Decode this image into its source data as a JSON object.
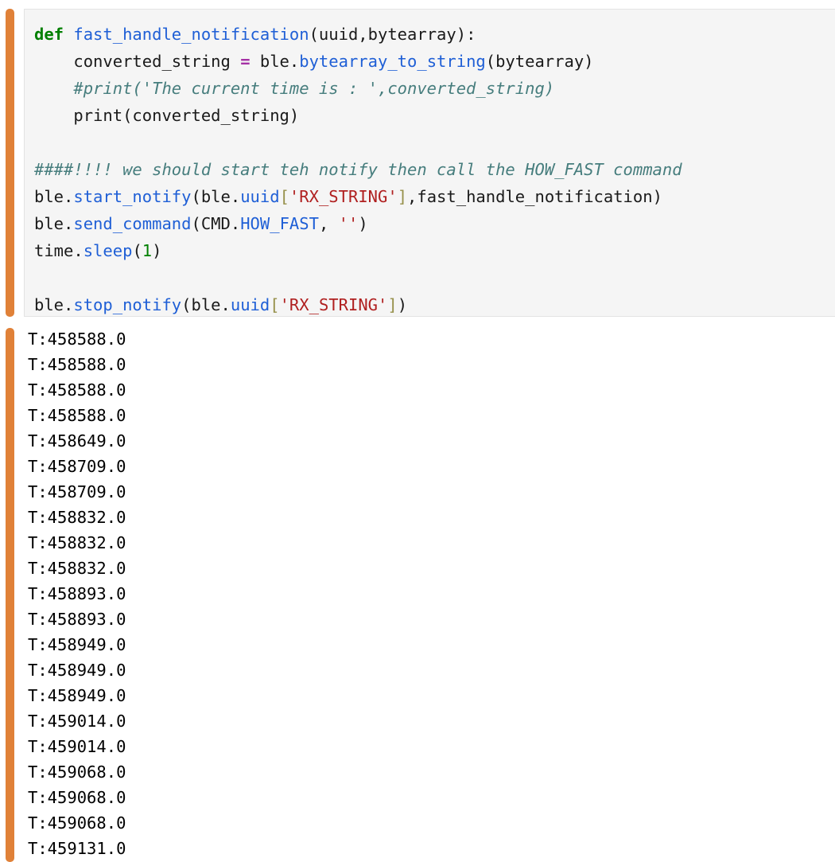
{
  "notebook": {
    "accent_color": "#E08138",
    "input_cell": {
      "background": "#f5f5f5",
      "border_color": "#e3e3e3",
      "language": "python",
      "lines": [
        [
          {
            "t": "def",
            "c": "tok-kw"
          },
          {
            "t": " ",
            "c": "tok-plain"
          },
          {
            "t": "fast_handle_notification",
            "c": "tok-fn"
          },
          {
            "t": "(uuid,bytearray):",
            "c": "tok-plain"
          }
        ],
        [
          {
            "t": "    converted_string ",
            "c": "tok-plain"
          },
          {
            "t": "=",
            "c": "tok-op"
          },
          {
            "t": " ble.",
            "c": "tok-plain"
          },
          {
            "t": "bytearray_to_string",
            "c": "tok-attr"
          },
          {
            "t": "(bytearray)",
            "c": "tok-plain"
          }
        ],
        [
          {
            "t": "    #print('The current time is : ',converted_string)",
            "c": "tok-comment"
          }
        ],
        [
          {
            "t": "    print(converted_string)",
            "c": "tok-plain"
          }
        ],
        [
          {
            "t": "",
            "c": "tok-plain"
          }
        ],
        [
          {
            "t": "####!!!! we should start teh notify then call the HOW_FAST command",
            "c": "tok-comment"
          }
        ],
        [
          {
            "t": "ble.",
            "c": "tok-plain"
          },
          {
            "t": "start_notify",
            "c": "tok-attr"
          },
          {
            "t": "(ble.",
            "c": "tok-plain"
          },
          {
            "t": "uuid",
            "c": "tok-attr"
          },
          {
            "t": "[",
            "c": "tok-brk"
          },
          {
            "t": "'RX_STRING'",
            "c": "tok-str"
          },
          {
            "t": "]",
            "c": "tok-brk"
          },
          {
            "t": ",fast_handle_notification)",
            "c": "tok-plain"
          }
        ],
        [
          {
            "t": "ble.",
            "c": "tok-plain"
          },
          {
            "t": "send_command",
            "c": "tok-attr"
          },
          {
            "t": "(CMD.",
            "c": "tok-plain"
          },
          {
            "t": "HOW_FAST",
            "c": "tok-attr"
          },
          {
            "t": ", ",
            "c": "tok-plain"
          },
          {
            "t": "''",
            "c": "tok-str"
          },
          {
            "t": ")",
            "c": "tok-plain"
          }
        ],
        [
          {
            "t": "time.",
            "c": "tok-plain"
          },
          {
            "t": "sleep",
            "c": "tok-attr"
          },
          {
            "t": "(",
            "c": "tok-plain"
          },
          {
            "t": "1",
            "c": "tok-num"
          },
          {
            "t": ")",
            "c": "tok-plain"
          }
        ],
        [
          {
            "t": "",
            "c": "tok-plain"
          }
        ],
        [
          {
            "t": "ble.",
            "c": "tok-plain"
          },
          {
            "t": "stop_notify",
            "c": "tok-attr"
          },
          {
            "t": "(ble.",
            "c": "tok-plain"
          },
          {
            "t": "uuid",
            "c": "tok-attr"
          },
          {
            "t": "[",
            "c": "tok-brk"
          },
          {
            "t": "'RX_STRING'",
            "c": "tok-str"
          },
          {
            "t": "]",
            "c": "tok-brk"
          },
          {
            "t": ")",
            "c": "tok-plain"
          }
        ]
      ],
      "source_text": "def fast_handle_notification(uuid,bytearray):\n    converted_string = ble.bytearray_to_string(bytearray)\n    #print('The current time is : ',converted_string)\n    print(converted_string)\n\n####!!!! we should start teh notify then call the HOW_FAST command\nble.start_notify(ble.uuid['RX_STRING'],fast_handle_notification)\nble.send_command(CMD.HOW_FAST, '')\ntime.sleep(1)\n\nble.stop_notify(ble.uuid['RX_STRING'])"
    },
    "output_cell": {
      "stream": "stdout",
      "lines": [
        "T:458588.0",
        "T:458588.0",
        "T:458588.0",
        "T:458588.0",
        "T:458649.0",
        "T:458709.0",
        "T:458709.0",
        "T:458832.0",
        "T:458832.0",
        "T:458832.0",
        "T:458893.0",
        "T:458893.0",
        "T:458949.0",
        "T:458949.0",
        "T:458949.0",
        "T:459014.0",
        "T:459014.0",
        "T:459068.0",
        "T:459068.0",
        "T:459068.0",
        "T:459131.0"
      ]
    }
  }
}
